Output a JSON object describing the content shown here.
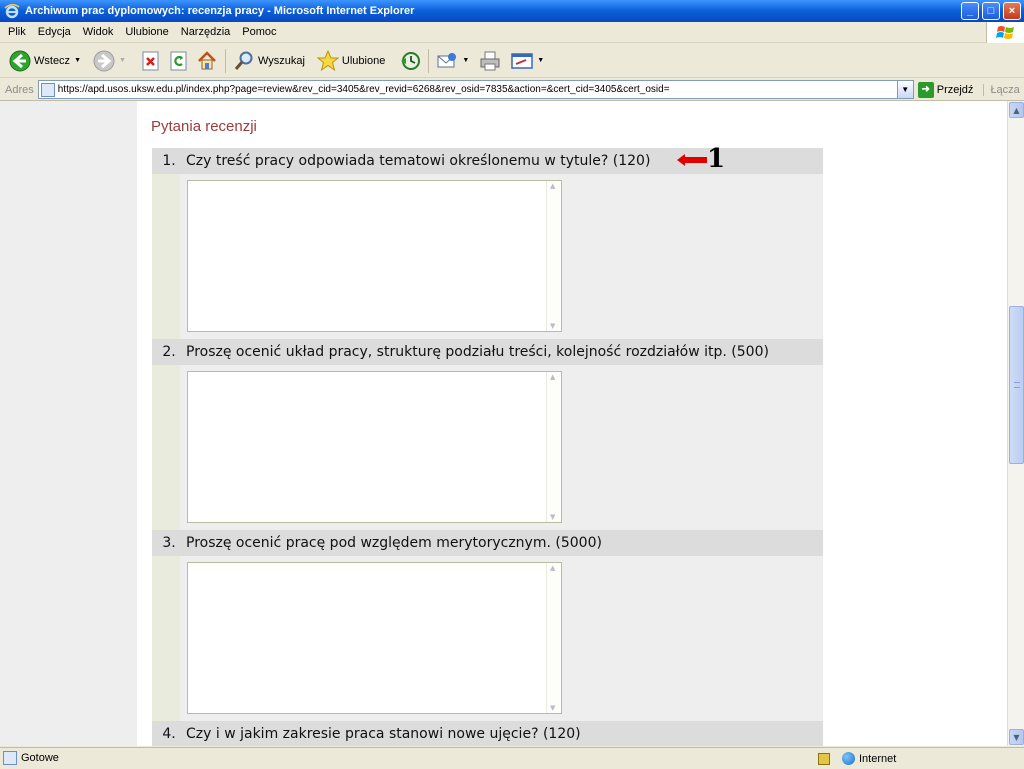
{
  "window": {
    "title": "Archiwum prac dyplomowych: recenzja pracy - Microsoft Internet Explorer",
    "min_glyph": "_",
    "max_glyph": "□",
    "close_glyph": "×"
  },
  "menu": [
    "Plik",
    "Edycja",
    "Widok",
    "Ulubione",
    "Narzędzia",
    "Pomoc"
  ],
  "toolbar": {
    "back_label": "Wstecz",
    "search_label": "Wyszukaj",
    "favorites_label": "Ulubione",
    "dropdown_glyph": "▼"
  },
  "address": {
    "label": "Adres",
    "url": "https://apd.usos.uksw.edu.pl/index.php?page=review&rev_cid=3405&rev_revid=6268&rev_osid=7835&action=&cert_cid=3405&cert_osid=",
    "go_label": "Przejdź",
    "links_label": "Łącza"
  },
  "page": {
    "section_title": "Pytania recenzji",
    "questions": [
      {
        "num": "1.",
        "text": "Czy treść pracy odpowiada tematowi określonemu w tytule? (120)"
      },
      {
        "num": "2.",
        "text": "Proszę ocenić układ pracy, strukturę podziału treści, kolejność rozdziałów itp. (500)"
      },
      {
        "num": "3.",
        "text": "Proszę ocenić pracę pod względem merytorycznym. (5000)"
      },
      {
        "num": "4.",
        "text": "Czy i w jakim zakresie praca stanowi nowe ujęcie? (120)"
      }
    ],
    "annotation_number": "1"
  },
  "status": {
    "text": "Gotowe",
    "zone": "Internet"
  },
  "colors": {
    "title_accent": "#9b3c3c",
    "annotation_arrow": "#e00000"
  }
}
